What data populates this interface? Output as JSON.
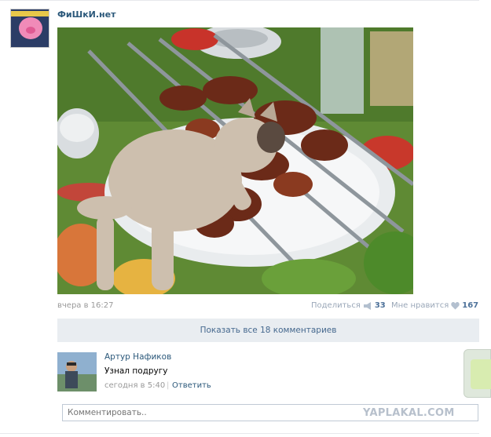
{
  "post": {
    "group_name": "ФиШкИ.нет",
    "date": "вчера в 16:27",
    "share_label": "Поделиться",
    "share_count": "33",
    "like_label": "Мне нравится",
    "like_count": "167",
    "show_comments_label": "Показать все 18 комментариев"
  },
  "comment": {
    "author": "Артур Нафиков",
    "text": "Узнал подругу",
    "time": "сегодня в 5:40",
    "separator": "|",
    "reply_label": "Ответить"
  },
  "composer": {
    "placeholder": "Комментировать.."
  },
  "watermark": "YAPLAKAL.COM",
  "colors": {
    "link": "#2b587a",
    "muted": "#999999",
    "button_bg": "#e9edf1",
    "accent_count": "#4e729a"
  }
}
